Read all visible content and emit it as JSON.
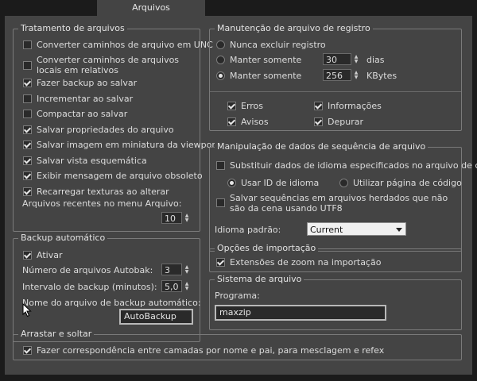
{
  "tab": {
    "label": "Arquivos"
  },
  "file_handling": {
    "title": "Tratamento de arquivos",
    "options": [
      {
        "label": "Converter caminhos de arquivo em UNC",
        "checked": false
      },
      {
        "label": "Converter caminhos de arquivos locais em relativos",
        "checked": false
      },
      {
        "label": "Fazer backup ao salvar",
        "checked": true
      },
      {
        "label": "Incrementar ao salvar",
        "checked": false
      },
      {
        "label": "Compactar ao salvar",
        "checked": false
      },
      {
        "label": "Salvar propriedades do arquivo",
        "checked": true
      },
      {
        "label": "Salvar imagem em miniatura da viewport",
        "checked": true
      },
      {
        "label": "Salvar vista esquemática",
        "checked": true
      },
      {
        "label": "Exibir mensagem de arquivo obsoleto",
        "checked": true
      },
      {
        "label": "Recarregar texturas ao alterar",
        "checked": true
      }
    ],
    "recent_label": "Arquivos recentes no menu Arquivo:",
    "recent_value": "10"
  },
  "autobackup": {
    "title": "Backup automático",
    "enable_label": "Ativar",
    "enable_checked": true,
    "count_label": "Número de arquivos Autobak:",
    "count_value": "3",
    "interval_label": "Intervalo de backup (minutos):",
    "interval_value": "5,0",
    "name_label": "Nome do arquivo de backup automático:",
    "name_value": "AutoBackup"
  },
  "log_maintenance": {
    "title": "Manutenção de arquivo de registro",
    "never_delete": "Nunca excluir registro",
    "keep_days_label": "Manter somente",
    "keep_days_value": "30",
    "days_unit": "dias",
    "keep_kb_label": "Manter somente",
    "keep_kb_value": "256",
    "kb_unit": "KBytes",
    "selected": "kbytes",
    "errors": "Erros",
    "info": "Informações",
    "warnings": "Avisos",
    "debug": "Depurar"
  },
  "sequence": {
    "title": "Manipulação de dados de sequência de arquivo",
    "replace_label": "Substituir dados de idioma especificados no arquivo de cena",
    "use_lang_id": "Usar ID de idioma",
    "use_codepage": "Utilizar página de código",
    "save_utf8": "Salvar sequências em arquivos herdados que não são da cena usando UTF8",
    "default_lang_label": "Idioma padrão:",
    "default_lang_value": "Current"
  },
  "import_options": {
    "title": "Opções de importação",
    "zoom_extents": "Extensões de zoom na importação"
  },
  "file_system": {
    "title": "Sistema de arquivo",
    "program_label": "Programa:",
    "program_value": "maxzip"
  },
  "drag_drop": {
    "title": "Arrastar e soltar",
    "match_label": "Fazer correspondência entre camadas por nome e pai, para mesclagem e refex"
  }
}
